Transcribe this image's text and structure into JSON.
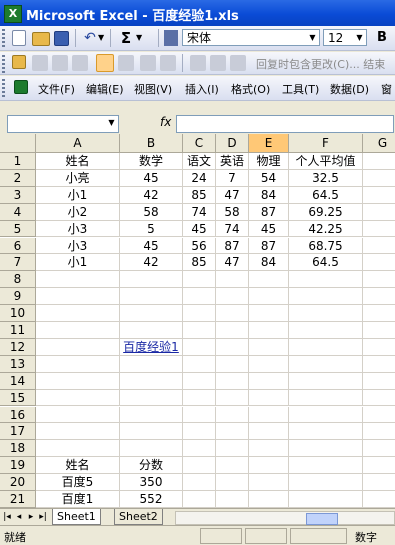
{
  "window": {
    "title": "Microsoft Excel - 百度经验1.xls"
  },
  "toolbar": {
    "sum_symbol": "Σ",
    "font_name": "宋体",
    "font_size": "12",
    "bold_label": "B"
  },
  "review_toolbar": {
    "text": "回复时包含更改(C)... 结束"
  },
  "menu": {
    "items": [
      "文件(F)",
      "编辑(E)",
      "视图(V)",
      "插入(I)",
      "格式(O)",
      "工具(T)",
      "数据(D)",
      "窗"
    ]
  },
  "formula_bar": {
    "name_box": "",
    "fx": "fx",
    "formula": ""
  },
  "sheet": {
    "columns": [
      "A",
      "B",
      "C",
      "D",
      "E",
      "F",
      "G"
    ],
    "selected_column": "E",
    "rows": [
      "1",
      "2",
      "3",
      "4",
      "5",
      "6",
      "7",
      "8",
      "9",
      "10",
      "11",
      "12",
      "13",
      "14",
      "15",
      "16",
      "17",
      "18",
      "19",
      "20",
      "21"
    ],
    "cells": {
      "A1": "姓名",
      "B1": "数学",
      "C1": "语文",
      "D1": "英语",
      "E1": "物理",
      "F1": "个人平均值",
      "A2": "小亮",
      "B2": "45",
      "C2": "24",
      "D2": "7",
      "E2": "54",
      "F2": "32.5",
      "A3": "小1",
      "B3": "42",
      "C3": "85",
      "D3": "47",
      "E3": "84",
      "F3": "64.5",
      "A4": "小2",
      "B4": "58",
      "C4": "74",
      "D4": "58",
      "E4": "87",
      "F4": "69.25",
      "A5": "小3",
      "B5": "5",
      "C5": "45",
      "D5": "74",
      "E5": "45",
      "F5": "42.25",
      "A6": "小3",
      "B6": "45",
      "C6": "56",
      "D6": "87",
      "E6": "87",
      "F6": "68.75",
      "A7": "小1",
      "B7": "42",
      "C7": "85",
      "D7": "47",
      "E7": "84",
      "F7": "64.5",
      "B12": "百度经验1",
      "A19": "姓名",
      "B19": "分数",
      "A20": "百度5",
      "B20": "350",
      "A21": "百度1",
      "B21": "552"
    }
  },
  "sheet_tabs": [
    "Sheet1",
    "Sheet2"
  ],
  "status": {
    "ready": "就绪",
    "num_lock": "数字"
  }
}
